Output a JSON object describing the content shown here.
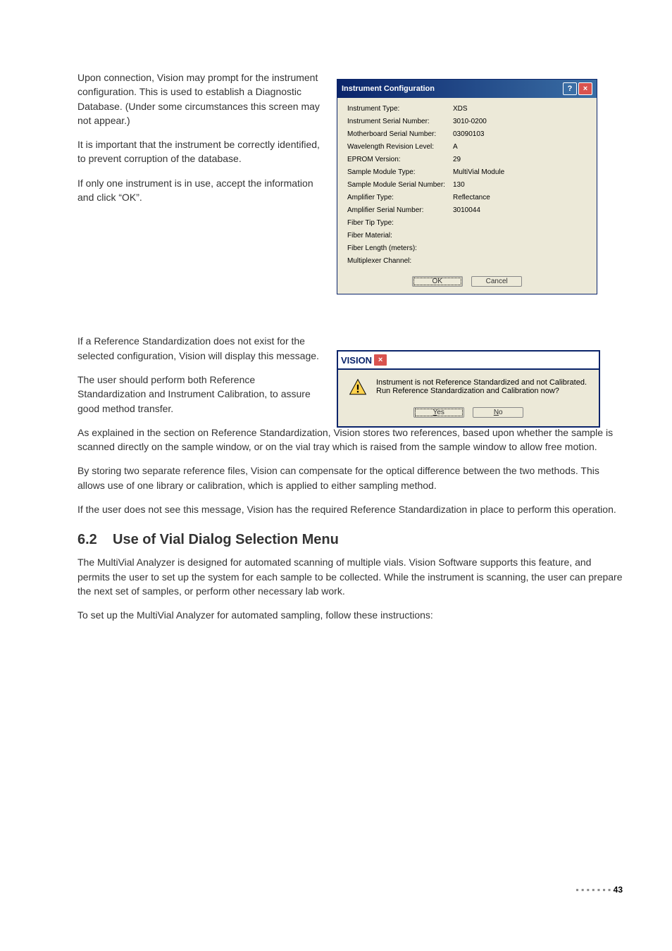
{
  "paragraphs": {
    "p1": "Upon connection, Vision may prompt for the instrument configuration. This is used to establish a Diagnostic Database. (Under some circumstances this screen may not appear.)",
    "p2": "It is important that the instrument be correctly identified, to prevent corruption of the database.",
    "p3": "If only one instrument is in use, accept the information and click “OK”.",
    "p4": "If a Reference Standardization does not exist for the selected configuration, Vision will display this message.",
    "p5": "The user should perform both Reference Standardization and Instrument Calibration, to assure good method transfer.",
    "p6": "As explained in the section on Reference Standardization, Vision stores two references, based upon whether the sample is scanned directly on the sample window, or on the vial tray which is raised from the sample window to allow free motion.",
    "p7": "By storing two separate reference files, Vision can compensate for the optical difference between the two methods. This allows use of one library or calibration, which is applied to either sampling method.",
    "p8": "If the user does not see this message, Vision has the required Reference Standardization in place to perform this operation.",
    "p9": "The MultiVial Analyzer is designed for automated scanning of multiple vials. Vision Software supports this feature, and permits the user to set up the system for each sample to be collected. While the instrument is scanning, the user can prepare the next set of samples, or perform other necessary lab work.",
    "p10": "To set up the MultiVial Analyzer for automated sampling, follow these instructions:"
  },
  "heading": {
    "num": "6.2",
    "title": "Use of Vial Dialog Selection Menu"
  },
  "dlg1": {
    "title": "Instrument Configuration",
    "fields": [
      {
        "label": "Instrument Type:",
        "value": "XDS"
      },
      {
        "label": "Instrument Serial Number:",
        "value": "3010-0200"
      },
      {
        "label": "Motherboard Serial Number:",
        "value": "03090103"
      },
      {
        "label": "Wavelength Revision Level:",
        "value": "A"
      },
      {
        "label": "EPROM Version:",
        "value": "29"
      },
      {
        "label": "Sample Module Type:",
        "value": "MultiVial Module"
      },
      {
        "label": "Sample Module Serial Number:",
        "value": "130"
      },
      {
        "label": "Amplifier Type:",
        "value": "Reflectance"
      },
      {
        "label": "Amplifier Serial Number:",
        "value": "3010044"
      },
      {
        "label": "Fiber Tip Type:",
        "value": ""
      },
      {
        "label": "Fiber Material:",
        "value": ""
      },
      {
        "label": "Fiber Length (meters):",
        "value": ""
      },
      {
        "label": "Multiplexer Channel:",
        "value": ""
      }
    ],
    "ok": "OK",
    "cancel": "Cancel"
  },
  "dlg2": {
    "title": "VISION",
    "msg1": "Instrument is not Reference Standardized and not Calibrated.",
    "msg2": "Run Reference Standardization and Calibration now?",
    "yes_u": "Y",
    "yes_rest": "es",
    "no_u": "N",
    "no_rest": "o"
  },
  "footer": {
    "dots": "▪ ▪ ▪ ▪ ▪ ▪ ▪",
    "page": "43"
  }
}
